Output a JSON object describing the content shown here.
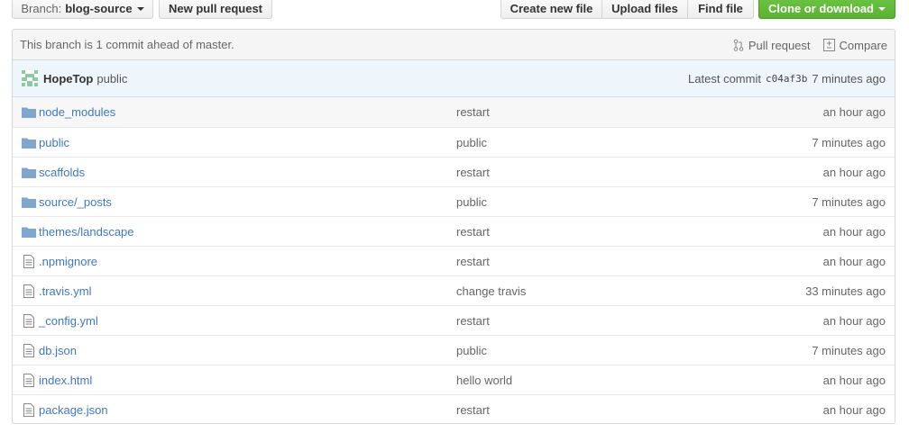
{
  "toolbar": {
    "branch_prefix": "Branch:",
    "branch_name": "blog-source",
    "new_pull_request": "New pull request",
    "create_new_file": "Create new file",
    "upload_files": "Upload files",
    "find_file": "Find file",
    "clone_or_download": "Clone or download"
  },
  "branch_info": {
    "message": "This branch is 1 commit ahead of master.",
    "pull_request": "Pull request",
    "compare": "Compare"
  },
  "commit": {
    "author": "HopeTop",
    "message": "public",
    "latest_label": "Latest commit",
    "sha": "c04af3b",
    "age": "7 minutes ago"
  },
  "files": [
    {
      "type": "dir",
      "name": "node_modules",
      "message": "restart",
      "age": "an hour ago"
    },
    {
      "type": "dir",
      "name": "public",
      "message": "public",
      "age": "7 minutes ago"
    },
    {
      "type": "dir",
      "name": "scaffolds",
      "message": "restart",
      "age": "an hour ago"
    },
    {
      "type": "dir",
      "name": "source/_posts",
      "message": "public",
      "age": "7 minutes ago"
    },
    {
      "type": "dir",
      "name": "themes/landscape",
      "message": "restart",
      "age": "an hour ago"
    },
    {
      "type": "file",
      "name": ".npmignore",
      "message": "restart",
      "age": "an hour ago"
    },
    {
      "type": "file",
      "name": ".travis.yml",
      "message": "change travis",
      "age": "33 minutes ago"
    },
    {
      "type": "file",
      "name": "_config.yml",
      "message": "restart",
      "age": "an hour ago"
    },
    {
      "type": "file",
      "name": "db.json",
      "message": "public",
      "age": "7 minutes ago"
    },
    {
      "type": "file",
      "name": "index.html",
      "message": "hello world",
      "age": "an hour ago"
    },
    {
      "type": "file",
      "name": "package.json",
      "message": "restart",
      "age": "an hour ago"
    }
  ],
  "icons": {
    "folder": "folder-icon",
    "file": "file-icon",
    "pull_request": "git-pull-request-icon",
    "compare": "diff-icon"
  },
  "colors": {
    "link": "#4078c0",
    "folder": "#80a6cd",
    "clone_button": "#6cc644",
    "commit_tease_bg": "#eef6fc"
  }
}
